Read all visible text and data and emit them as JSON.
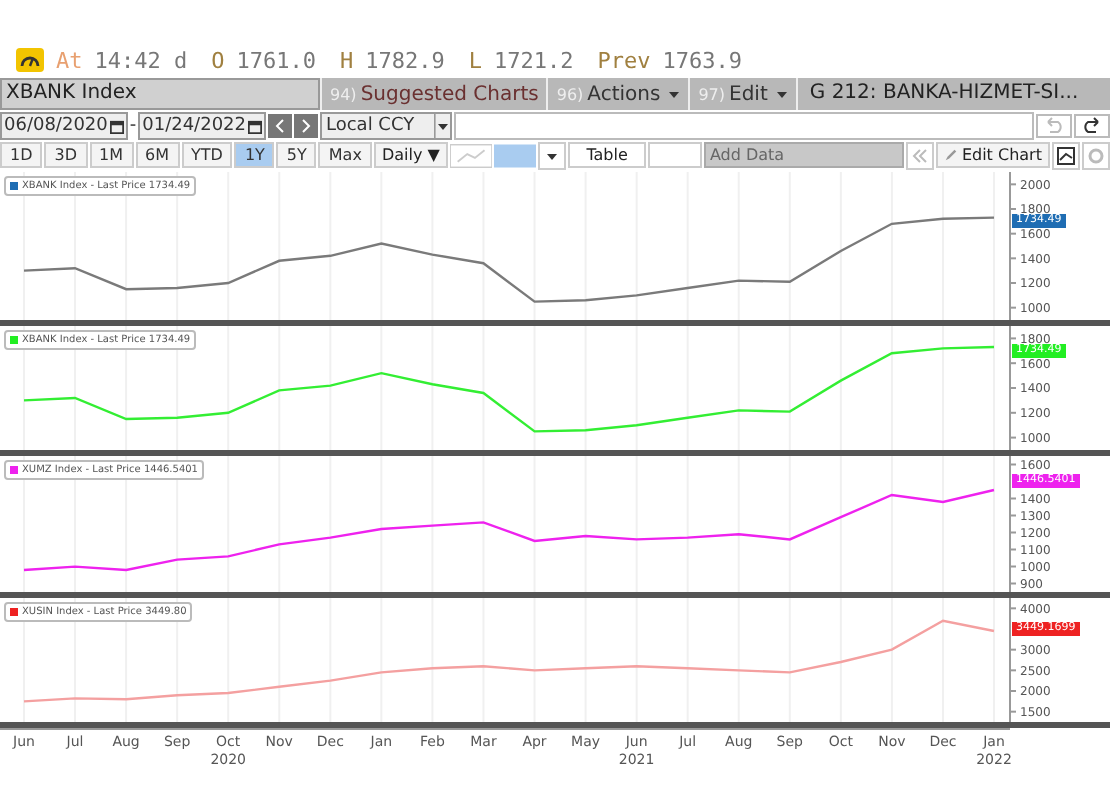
{
  "quote": {
    "at_label": "At",
    "time": "14:42 d",
    "fields": [
      {
        "label": "O",
        "value": "1761.0"
      },
      {
        "label": "H",
        "value": "1782.9"
      },
      {
        "label": "L",
        "value": "1721.2"
      },
      {
        "label": "Prev",
        "value": "1763.9"
      }
    ]
  },
  "header": {
    "security": "XBANK Index",
    "menus": [
      {
        "number": "94)",
        "label": "Suggested Charts",
        "dropdown": false
      },
      {
        "number": "96)",
        "label": "Actions",
        "dropdown": true
      },
      {
        "number": "97)",
        "label": "Edit",
        "dropdown": true
      }
    ],
    "group": "G 212: BANKA-HIZMET-SI..."
  },
  "date_range": {
    "start": "06/08/2020",
    "separator": "-",
    "end": "01/24/2022",
    "currency": "Local CCY"
  },
  "periods": [
    {
      "label": "1D",
      "selected": false
    },
    {
      "label": "3D",
      "selected": false
    },
    {
      "label": "1M",
      "selected": false
    },
    {
      "label": "6M",
      "selected": false
    },
    {
      "label": "YTD",
      "selected": false
    },
    {
      "label": "1Y",
      "selected": true
    },
    {
      "label": "5Y",
      "selected": false
    },
    {
      "label": "Max",
      "selected": false
    }
  ],
  "frequency": "Daily ▼",
  "table_button": "Table",
  "add_data": {
    "placeholder": "Add Data"
  },
  "edit_chart": "Edit Chart",
  "panels": [
    {
      "legend": "XBANK Index - Last Price 1734.49",
      "tag": "1734.49",
      "color": "#1f6db3",
      "chart_data": {
        "type": "line",
        "grid": true,
        "series": [
          {
            "color": "#7a7a7a",
            "values": [
              1300,
              1320,
              1150,
              1160,
              1200,
              1380,
              1420,
              1520,
              1430,
              1360,
              1050,
              1060,
              1100,
              1160,
              1220,
              1210,
              1460,
              1680,
              1720,
              1730
            ]
          }
        ],
        "ylim": [
          900,
          2100
        ],
        "yticks": [
          1000,
          1200,
          1400,
          1600,
          1800,
          2000
        ]
      }
    },
    {
      "legend": "XBANK Index - Last Price 1734.49",
      "tag": "1734.49",
      "color": "#22ee22",
      "chart_data": {
        "type": "line",
        "grid": true,
        "series": [
          {
            "color": "#33ee33",
            "values": [
              1300,
              1320,
              1150,
              1160,
              1200,
              1380,
              1420,
              1520,
              1430,
              1360,
              1050,
              1060,
              1100,
              1160,
              1220,
              1210,
              1460,
              1680,
              1720,
              1730
            ]
          }
        ],
        "ylim": [
          900,
          1900
        ],
        "yticks": [
          1000,
          1200,
          1400,
          1600,
          1800
        ]
      }
    },
    {
      "legend": "XUMZ Index - Last Price 1446.5401",
      "tag": "1446.5401",
      "color": "#ee22ee",
      "chart_data": {
        "type": "line",
        "grid": true,
        "series": [
          {
            "color": "#ee22ee",
            "values": [
              980,
              1000,
              980,
              1040,
              1060,
              1130,
              1170,
              1220,
              1240,
              1260,
              1150,
              1180,
              1160,
              1170,
              1190,
              1160,
              1290,
              1420,
              1380,
              1450
            ]
          }
        ],
        "ylim": [
          850,
          1650
        ],
        "yticks": [
          900,
          1000,
          1100,
          1200,
          1300,
          1400,
          1600
        ]
      }
    },
    {
      "legend": "XUSIN Index - Last Price 3449.80",
      "tag": "3449.1699",
      "color": "#ee2222",
      "chart_data": {
        "type": "line",
        "grid": true,
        "series": [
          {
            "color": "#f4a0a0",
            "values": [
              1750,
              1820,
              1800,
              1900,
              1950,
              2100,
              2250,
              2450,
              2550,
              2600,
              2500,
              2550,
              2600,
              2550,
              2500,
              2450,
              2700,
              3000,
              3700,
              3450
            ]
          }
        ],
        "ylim": [
          1250,
          4250
        ],
        "yticks": [
          1500,
          2000,
          2500,
          3000,
          4000
        ]
      }
    }
  ],
  "x_axis": {
    "months": [
      {
        "label": "Jun"
      },
      {
        "label": "Jul"
      },
      {
        "label": "Aug"
      },
      {
        "label": "Sep"
      },
      {
        "label": "Oct",
        "year": "2020"
      },
      {
        "label": "Nov"
      },
      {
        "label": "Dec"
      },
      {
        "label": "Jan"
      },
      {
        "label": "Feb"
      },
      {
        "label": "Mar"
      },
      {
        "label": "Apr"
      },
      {
        "label": "May"
      },
      {
        "label": "Jun",
        "year": "2021"
      },
      {
        "label": "Jul"
      },
      {
        "label": "Aug"
      },
      {
        "label": "Sep"
      },
      {
        "label": "Oct"
      },
      {
        "label": "Nov"
      },
      {
        "label": "Dec"
      },
      {
        "label": "Jan",
        "year": "2022"
      }
    ]
  }
}
